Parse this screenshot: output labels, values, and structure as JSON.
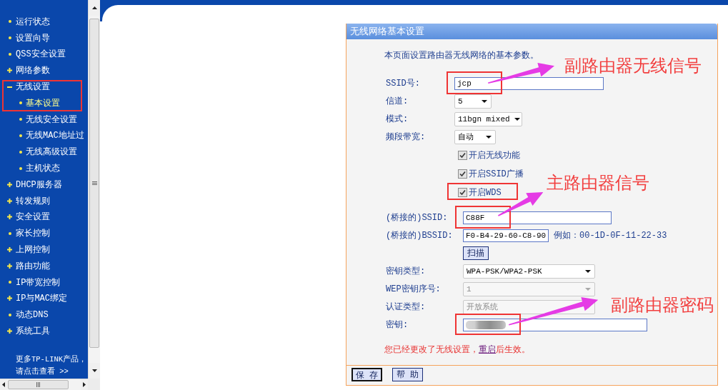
{
  "sidebar": {
    "items": [
      {
        "kind": "page",
        "label": "运行状态",
        "selected": false,
        "highlighted": false
      },
      {
        "kind": "page",
        "label": "设置向导",
        "selected": false,
        "highlighted": false
      },
      {
        "kind": "page",
        "label": "QSS安全设置",
        "selected": false,
        "highlighted": false
      },
      {
        "kind": "group",
        "label": "网络参数",
        "expanded": false,
        "selected": false,
        "highlighted": false
      },
      {
        "kind": "group",
        "label": "无线设置",
        "expanded": true,
        "selected": false,
        "highlighted": true,
        "children": [
          {
            "kind": "page",
            "label": "基本设置",
            "selected": true
          },
          {
            "kind": "page",
            "label": "无线安全设置",
            "selected": false
          },
          {
            "kind": "page",
            "label": "无线MAC地址过",
            "selected": false
          },
          {
            "kind": "page",
            "label": "无线高级设置",
            "selected": false
          },
          {
            "kind": "page",
            "label": "主机状态",
            "selected": false
          }
        ]
      },
      {
        "kind": "group",
        "label": "DHCP服务器",
        "expanded": false,
        "selected": false,
        "highlighted": false
      },
      {
        "kind": "group",
        "label": "转发规则",
        "expanded": false,
        "selected": false,
        "highlighted": false
      },
      {
        "kind": "group",
        "label": "安全设置",
        "expanded": false,
        "selected": false,
        "highlighted": false
      },
      {
        "kind": "page",
        "label": "家长控制",
        "selected": false,
        "highlighted": false
      },
      {
        "kind": "group",
        "label": "上网控制",
        "expanded": false,
        "selected": false,
        "highlighted": false
      },
      {
        "kind": "group",
        "label": "路由功能",
        "expanded": false,
        "selected": false,
        "highlighted": false
      },
      {
        "kind": "page",
        "label": "IP带宽控制",
        "selected": false,
        "highlighted": false
      },
      {
        "kind": "group",
        "label": "IP与MAC绑定",
        "expanded": false,
        "selected": false,
        "highlighted": false
      },
      {
        "kind": "page",
        "label": "动态DNS",
        "selected": false,
        "highlighted": false
      },
      {
        "kind": "group",
        "label": "系统工具",
        "expanded": false,
        "selected": false,
        "highlighted": false
      }
    ],
    "more_link": "更多TP-LINK产品，请点击查看 >>"
  },
  "panel": {
    "title": "无线网络基本设置",
    "intro": "本页面设置路由器无线网络的基本参数。",
    "fields": [
      {
        "kind": "text",
        "label": "SSID号:",
        "value": "jcp",
        "disabled": false,
        "highlighted": true
      },
      {
        "kind": "select",
        "label": "信道:",
        "value": "5",
        "disabled": false,
        "highlighted": false
      },
      {
        "kind": "select",
        "label": "模式:",
        "value": "11bgn mixed",
        "disabled": false,
        "highlighted": false
      },
      {
        "kind": "select",
        "label": "频段带宽:",
        "value": "自动",
        "disabled": false,
        "highlighted": false
      },
      {
        "kind": "checkbox",
        "label": "开启无线功能",
        "checked": true,
        "disabled": false,
        "highlighted": false
      },
      {
        "kind": "checkbox",
        "label": "开启SSID广播",
        "checked": true,
        "disabled": false,
        "highlighted": false
      },
      {
        "kind": "checkbox",
        "label": "开启WDS",
        "checked": true,
        "disabled": false,
        "highlighted": true
      }
    ],
    "wds_fields": [
      {
        "kind": "text",
        "label": "(桥接的)SSID:",
        "value": "C88F",
        "disabled": false,
        "highlighted": true
      },
      {
        "kind": "text",
        "label": "(桥接的)BSSID:",
        "value": "F0-B4-29-60-C8-90",
        "hint": "例如：00-1D-0F-11-22-33",
        "disabled": false,
        "highlighted": false
      },
      {
        "kind": "button",
        "label": "扫描",
        "disabled": false,
        "highlighted": false
      },
      {
        "kind": "select",
        "label": "密钥类型:",
        "value": "WPA-PSK/WPA2-PSK",
        "disabled": false,
        "highlighted": false
      },
      {
        "kind": "select",
        "label": "WEP密钥序号:",
        "value": "1",
        "disabled": true,
        "highlighted": false
      },
      {
        "kind": "select",
        "label": "认证类型:",
        "value": "开放系统",
        "disabled": true,
        "highlighted": false
      },
      {
        "kind": "password",
        "label": "密钥:",
        "redacted": true,
        "disabled": false,
        "highlighted": true
      }
    ],
    "notice": {
      "before": "您已经更改了无线设置，",
      "link": "重启",
      "after": "后生效。"
    },
    "buttons": [
      {
        "label": "保 存",
        "focused": true
      },
      {
        "label": "帮 助",
        "focused": false
      }
    ]
  },
  "annotations": [
    {
      "text": "副路由器无线信号"
    },
    {
      "text": "主路由器信号"
    },
    {
      "text": "副路由器密码"
    }
  ]
}
